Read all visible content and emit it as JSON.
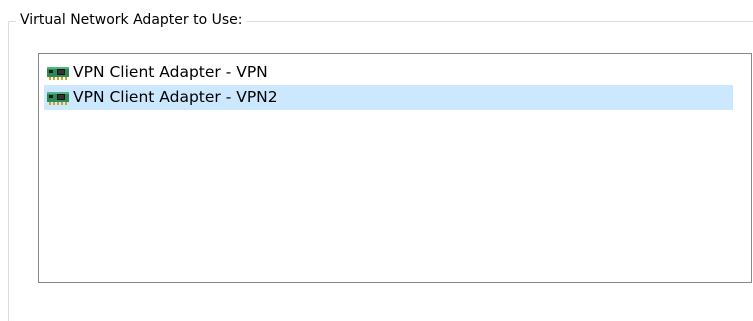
{
  "group": {
    "title": "Virtual Network Adapter to Use:"
  },
  "adapter_list": {
    "items": [
      {
        "label": "VPN Client Adapter - VPN",
        "icon": "network-adapter-icon",
        "selected": false
      },
      {
        "label": "VPN Client Adapter - VPN2",
        "icon": "network-adapter-icon",
        "selected": true
      }
    ]
  },
  "colors": {
    "selection": "#cce8ff",
    "list_border": "#828790",
    "group_border": "#dcdcdc",
    "adapter_icon_green": "#2a8a5a"
  }
}
